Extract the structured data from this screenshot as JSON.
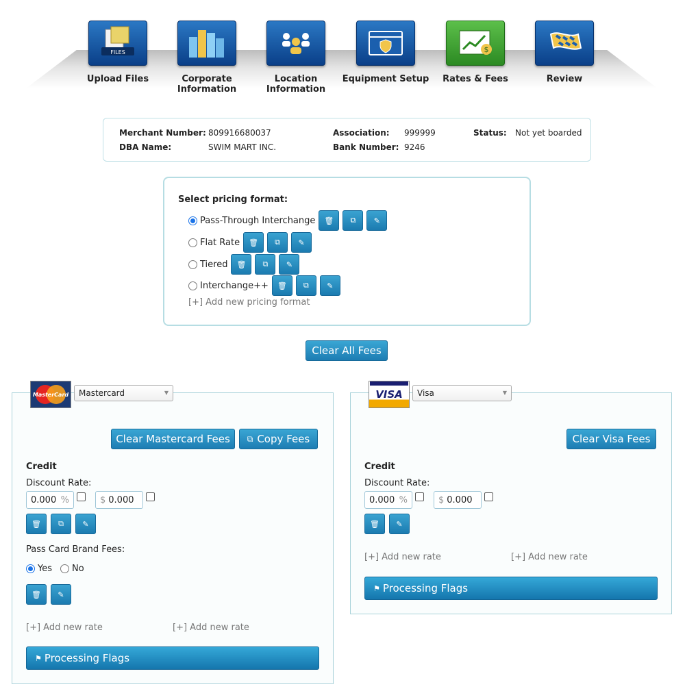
{
  "wizard": {
    "steps": [
      {
        "label": "Upload Files",
        "icon": "upload-files-icon",
        "icon_text": "FILES"
      },
      {
        "label": "Corporate Information",
        "icon": "buildings-icon"
      },
      {
        "label": "Location Information",
        "icon": "people-icon"
      },
      {
        "label": "Equipment Setup",
        "icon": "browser-shield-icon"
      },
      {
        "label": "Rates & Fees",
        "icon": "chart-dollar-icon"
      },
      {
        "label": "Review",
        "icon": "checkered-flag-icon"
      }
    ],
    "active_color": "#3e9a2f",
    "default_color": "#0d4a9a"
  },
  "merchant": {
    "merchant_number_label": "Merchant Number:",
    "merchant_number": "809916680037",
    "dba_label": "DBA Name:",
    "dba": "SWIM MART INC.",
    "association_label": "Association:",
    "association": "999999",
    "bank_number_label": "Bank Number:",
    "bank_number": "9246",
    "status_label": "Status:",
    "status": "Not yet boarded"
  },
  "pricing": {
    "title": "Select pricing format:",
    "options": [
      {
        "label": "Pass-Through Interchange",
        "selected": true
      },
      {
        "label": "Flat Rate",
        "selected": false
      },
      {
        "label": "Tiered",
        "selected": false
      },
      {
        "label": "Interchange++",
        "selected": false
      }
    ],
    "add_label": "[+] Add new pricing format"
  },
  "clear_all_label": "Clear All Fees",
  "mastercard": {
    "logo_text": "MasterCard",
    "select_value": "Mastercard",
    "clear_label": "Clear Mastercard Fees",
    "copy_label": "Copy Fees",
    "section": "Credit",
    "discount_label": "Discount Rate:",
    "rate_value": "0.000",
    "rate_suffix": "%",
    "amount_prefix": "$",
    "amount_value": "0.000",
    "brand_fees_label": "Pass Card Brand Fees:",
    "yes_label": "Yes",
    "no_label": "No",
    "brand_fees_value": "Yes",
    "add_rate_1": "[+] Add new rate",
    "add_rate_2": "[+] Add new rate",
    "flags_label": "Processing Flags"
  },
  "visa": {
    "logo_text": "VISA",
    "select_value": "Visa",
    "clear_label": "Clear Visa Fees",
    "section": "Credit",
    "discount_label": "Discount Rate:",
    "rate_value": "0.000",
    "rate_suffix": "%",
    "amount_prefix": "$",
    "amount_value": "0.000",
    "add_rate_1": "[+] Add new rate",
    "add_rate_2": "[+] Add new rate",
    "flags_label": "Processing Flags"
  },
  "colors": {
    "button": "#1d7db3",
    "panel_border": "#a9d2da",
    "radio": "#1a73e8"
  }
}
